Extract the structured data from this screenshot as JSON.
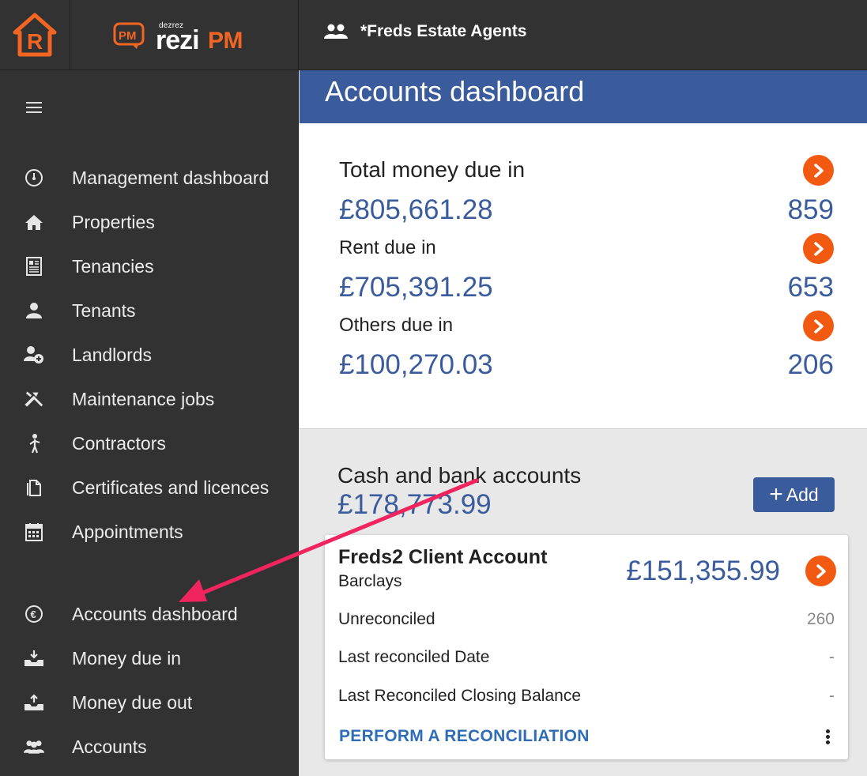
{
  "header": {
    "brand_small": "dezrez",
    "brand_rezi": "rezi",
    "brand_pm": "PM",
    "brand_badge": "PM",
    "agency_name": "*Freds Estate Agents"
  },
  "sidebar": {
    "items": [
      {
        "label": "Management dashboard",
        "icon": "speedometer-icon"
      },
      {
        "label": "Properties",
        "icon": "home-icon"
      },
      {
        "label": "Tenancies",
        "icon": "document-list-icon"
      },
      {
        "label": "Tenants",
        "icon": "person-icon"
      },
      {
        "label": "Landlords",
        "icon": "person-add-icon"
      },
      {
        "label": "Maintenance jobs",
        "icon": "tools-icon"
      },
      {
        "label": "Contractors",
        "icon": "worker-icon"
      },
      {
        "label": "Certificates and licences",
        "icon": "files-icon"
      },
      {
        "label": "Appointments",
        "icon": "calendar-icon"
      },
      {
        "label": "Accounts dashboard",
        "icon": "euro-circle-icon"
      },
      {
        "label": "Money due in",
        "icon": "inbox-download-icon"
      },
      {
        "label": "Money due out",
        "icon": "outbox-upload-icon"
      },
      {
        "label": "Accounts",
        "icon": "people-icon"
      }
    ]
  },
  "main": {
    "title": "Accounts dashboard",
    "totals": [
      {
        "label": "Total money due in",
        "amount": "£805,661.28",
        "count": "859"
      },
      {
        "label": "Rent due in",
        "amount": "£705,391.25",
        "count": "653"
      },
      {
        "label": "Others due in",
        "amount": "£100,270.03",
        "count": "206"
      }
    ],
    "cash": {
      "title": "Cash and bank accounts",
      "amount": "£178,773.99",
      "add_label": "Add"
    },
    "account_card": {
      "name": "Freds2 Client Account",
      "bank": "Barclays",
      "balance": "£151,355.99",
      "rows": [
        {
          "label": "Unreconciled",
          "value": "260"
        },
        {
          "label": "Last reconciled Date",
          "value": "-"
        },
        {
          "label": "Last Reconciled Closing Balance",
          "value": "-"
        }
      ],
      "action_label": "PERFORM A RECONCILIATION"
    }
  },
  "colors": {
    "sidebar_bg": "#323232",
    "header_band": "#3a5b9c",
    "accent_orange": "#f25a12",
    "amount_blue": "#3a5b9c",
    "annotation_arrow": "#f0245f"
  }
}
